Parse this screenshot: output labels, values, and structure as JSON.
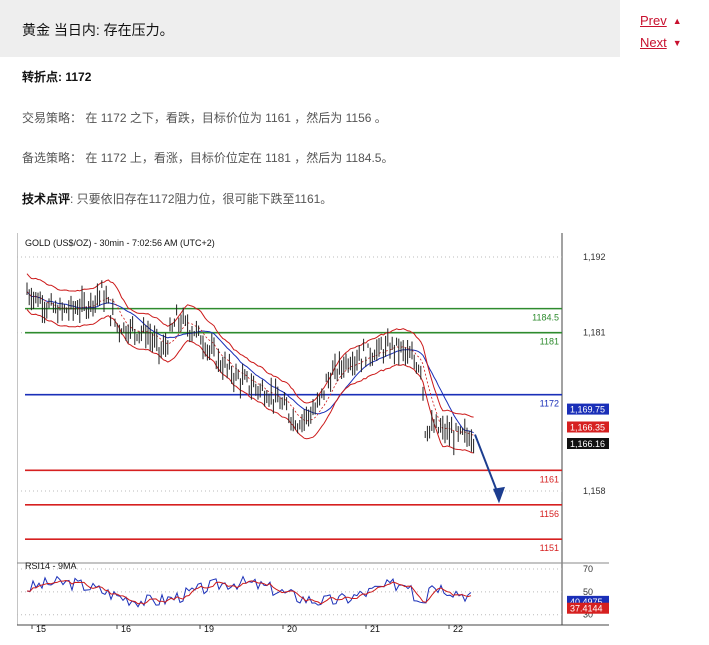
{
  "page": {
    "title": "黄金 当日内: 存在压力。",
    "nav": {
      "prev": "Prev",
      "next": "Next"
    },
    "pivot": {
      "label": "转折点:",
      "value": "1172"
    },
    "strategy": {
      "label": "交易策略：",
      "text": "在 1172 之下，看跌，目标价位为 1161 ，然后为 1156 。"
    },
    "alternative": {
      "label": "备选策略：",
      "text": "在 1172 上，看涨，目标价位定在 1181 ，然后为 1184.5。"
    },
    "comment": {
      "label": "技术点评",
      "text": ": 只要依旧存在1172阻力位，很可能下跌至1161。"
    }
  },
  "chart": {
    "header": "GOLD (US$/OZ) - 30min - 7:02:56 AM (UTC+2)",
    "y_ticks": [
      "1,192",
      "1,181",
      "1,158"
    ],
    "levels": [
      {
        "value": 1184.5,
        "label": "1184.5",
        "color": "#2e8b2e"
      },
      {
        "value": 1181,
        "label": "1181",
        "color": "#2e8b2e"
      },
      {
        "value": 1172,
        "label": "1172",
        "color": "#1a2fb8"
      },
      {
        "value": 1161,
        "label": "1161",
        "color": "#d62020"
      },
      {
        "value": 1156,
        "label": "1156",
        "color": "#d62020"
      },
      {
        "value": 1151,
        "label": "1151",
        "color": "#d62020"
      }
    ],
    "price_tags": [
      {
        "text": "1,169.75",
        "bg": "#1a2fb8",
        "fg": "#ffffff"
      },
      {
        "text": "1,166.35",
        "bg": "#d62020",
        "fg": "#ffffff"
      },
      {
        "text": "1,166.16",
        "bg": "#111111",
        "fg": "#ffffff"
      }
    ],
    "rsi": {
      "label": "RSI14 - 9MA",
      "ticks": [
        "70",
        "50",
        "30"
      ],
      "tags": [
        {
          "text": "40.4975",
          "bg": "#1a2fb8",
          "fg": "#ffffff"
        },
        {
          "text": "37.4144",
          "bg": "#d62020",
          "fg": "#ffffff"
        }
      ]
    },
    "x_ticks": [
      "15",
      "16",
      "19",
      "20",
      "21",
      "22"
    ],
    "colors": {
      "candle": "#222222",
      "bands": "#cc1a1a",
      "ma": "#1a2fb8",
      "forecast": "#1c3d8f"
    }
  }
}
